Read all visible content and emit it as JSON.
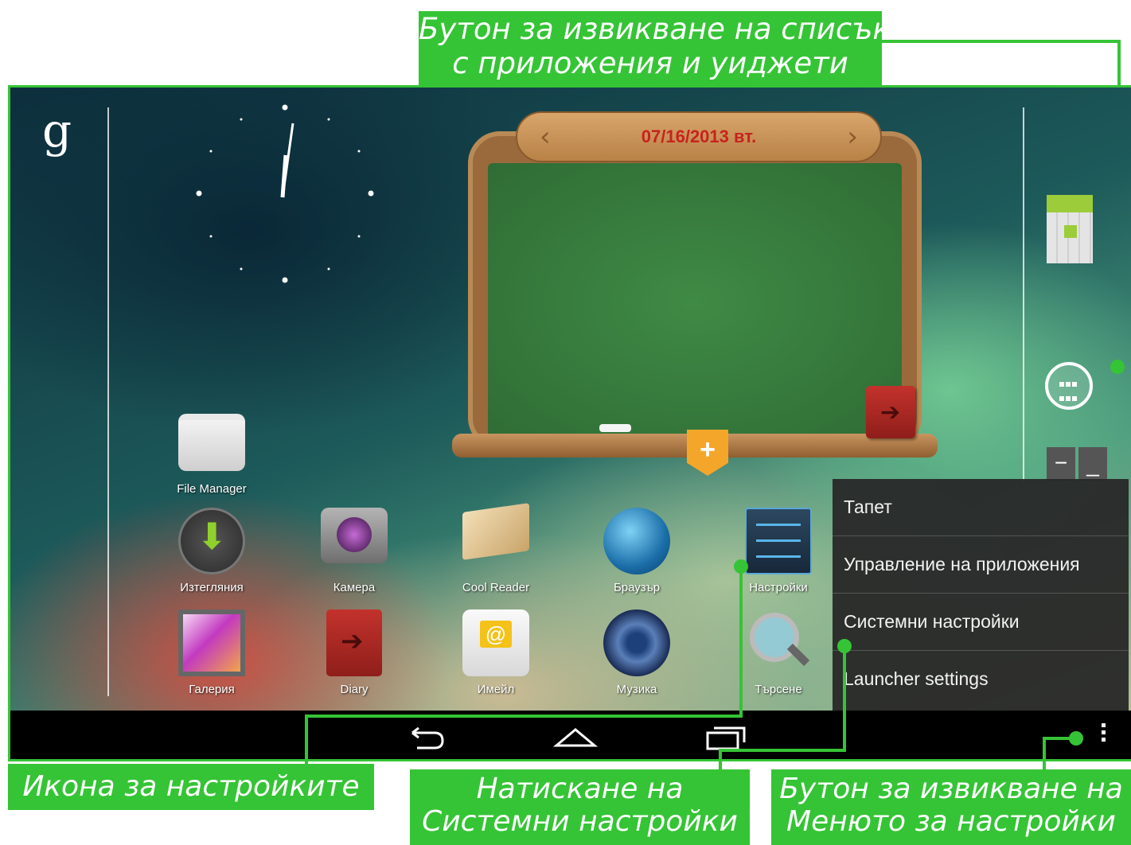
{
  "callouts": {
    "top_line1": "Бутон за извикване на списък",
    "top_line2": "с приложения и уиджети",
    "left": "Икона за настройките",
    "mid_line1": "Натискане на",
    "mid_line2": "Системни настройки",
    "right_line1": "Бутон за извикване на",
    "right_line2": "Менюто за настройки"
  },
  "screen": {
    "google_search_label": "g",
    "board_widget": {
      "date": "07/16/2013 вт.",
      "prev_glyph": "‹",
      "next_glyph": "›",
      "add_glyph": "+"
    },
    "dock": {
      "zoom_minus": "−",
      "zoom_max": "_"
    },
    "apps": [
      {
        "label": "File Manager",
        "icon": "folder-icon"
      },
      {
        "label": "Изтегляния",
        "icon": "download-icon"
      },
      {
        "label": "Камера",
        "icon": "camera-icon"
      },
      {
        "label": "Cool Reader",
        "icon": "book-icon"
      },
      {
        "label": "Браузър",
        "icon": "globe-icon"
      },
      {
        "label": "Настройки",
        "icon": "settings-sliders-icon"
      },
      {
        "label": "Галерия",
        "icon": "gallery-icon"
      },
      {
        "label": "Diary",
        "icon": "diary-icon"
      },
      {
        "label": "Имейл",
        "icon": "email-icon"
      },
      {
        "label": "Музика",
        "icon": "speaker-icon"
      },
      {
        "label": "Търсене",
        "icon": "magnifier-icon"
      }
    ],
    "menu": {
      "items": [
        "Тапет",
        "Управление на приложения",
        "Системни настройки",
        "Launcher settings"
      ]
    }
  },
  "colors": {
    "callout_green": "#35c435",
    "date_red": "#c8221e",
    "board_green": "#3f8a45"
  }
}
